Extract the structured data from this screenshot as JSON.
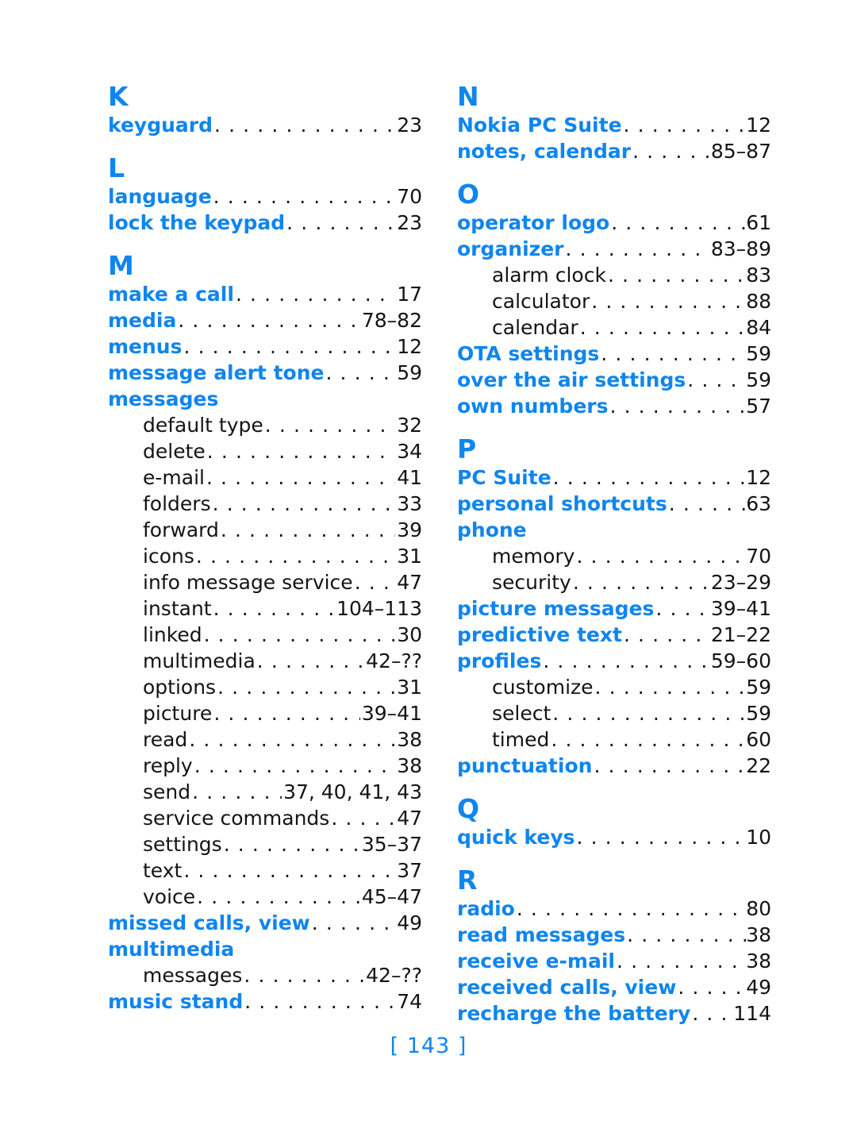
{
  "document": {
    "type": "index",
    "footer_page_label": "[ 143 ]"
  },
  "columns": [
    {
      "id": "left",
      "blocks": [
        {
          "kind": "letter",
          "letter": "K"
        },
        {
          "kind": "entry",
          "level": "main",
          "label": "keyguard",
          "page": "23"
        },
        {
          "kind": "letter",
          "letter": "L"
        },
        {
          "kind": "entry",
          "level": "main",
          "label": "language",
          "page": "70"
        },
        {
          "kind": "entry",
          "level": "main",
          "label": "lock the keypad",
          "page": "23"
        },
        {
          "kind": "letter",
          "letter": "M"
        },
        {
          "kind": "entry",
          "level": "main",
          "label": "make a call",
          "page": "17"
        },
        {
          "kind": "entry",
          "level": "main",
          "label": "media",
          "page": "78–82"
        },
        {
          "kind": "entry",
          "level": "main",
          "label": "menus",
          "page": "12"
        },
        {
          "kind": "entry",
          "level": "main",
          "label": "message alert tone",
          "page": "59"
        },
        {
          "kind": "entry",
          "level": "main",
          "label": "messages",
          "page": ""
        },
        {
          "kind": "entry",
          "level": "sub",
          "label": "default type",
          "page": "32"
        },
        {
          "kind": "entry",
          "level": "sub",
          "label": "delete",
          "page": "34"
        },
        {
          "kind": "entry",
          "level": "sub",
          "label": "e-mail",
          "page": "41"
        },
        {
          "kind": "entry",
          "level": "sub",
          "label": "folders",
          "page": "33"
        },
        {
          "kind": "entry",
          "level": "sub",
          "label": "forward",
          "page": "39"
        },
        {
          "kind": "entry",
          "level": "sub",
          "label": "icons",
          "page": "31"
        },
        {
          "kind": "entry",
          "level": "sub",
          "label": "info message service",
          "page": "47"
        },
        {
          "kind": "entry",
          "level": "sub",
          "label": "instant",
          "page": "104–113"
        },
        {
          "kind": "entry",
          "level": "sub",
          "label": "linked",
          "page": "30"
        },
        {
          "kind": "entry",
          "level": "sub",
          "label": "multimedia",
          "page": "42–??"
        },
        {
          "kind": "entry",
          "level": "sub",
          "label": "options",
          "page": "31"
        },
        {
          "kind": "entry",
          "level": "sub",
          "label": "picture",
          "page": "39–41"
        },
        {
          "kind": "entry",
          "level": "sub",
          "label": "read",
          "page": "38"
        },
        {
          "kind": "entry",
          "level": "sub",
          "label": "reply",
          "page": "38"
        },
        {
          "kind": "entry",
          "level": "sub",
          "label": "send",
          "page": "37, 40, 41, 43"
        },
        {
          "kind": "entry",
          "level": "sub",
          "label": "service commands",
          "page": "47"
        },
        {
          "kind": "entry",
          "level": "sub",
          "label": "settings",
          "page": "35–37"
        },
        {
          "kind": "entry",
          "level": "sub",
          "label": "text",
          "page": "37"
        },
        {
          "kind": "entry",
          "level": "sub",
          "label": "voice",
          "page": "45–47"
        },
        {
          "kind": "entry",
          "level": "main",
          "label": "missed calls, view",
          "page": "49"
        },
        {
          "kind": "entry",
          "level": "main",
          "label": "multimedia",
          "page": ""
        },
        {
          "kind": "entry",
          "level": "sub",
          "label": "messages",
          "page": "42–??"
        },
        {
          "kind": "entry",
          "level": "main",
          "label": "music stand",
          "page": "74"
        }
      ]
    },
    {
      "id": "right",
      "blocks": [
        {
          "kind": "letter",
          "letter": "N"
        },
        {
          "kind": "entry",
          "level": "main",
          "label": "Nokia PC Suite",
          "page": "12"
        },
        {
          "kind": "entry",
          "level": "main",
          "label": "notes, calendar",
          "page": "85–87"
        },
        {
          "kind": "letter",
          "letter": "O"
        },
        {
          "kind": "entry",
          "level": "main",
          "label": "operator logo",
          "page": "61"
        },
        {
          "kind": "entry",
          "level": "main",
          "label": "organizer",
          "page": "83–89"
        },
        {
          "kind": "entry",
          "level": "sub",
          "label": "alarm clock",
          "page": "83"
        },
        {
          "kind": "entry",
          "level": "sub",
          "label": "calculator",
          "page": "88"
        },
        {
          "kind": "entry",
          "level": "sub",
          "label": "calendar",
          "page": "84"
        },
        {
          "kind": "entry",
          "level": "main",
          "label": "OTA settings",
          "page": "59"
        },
        {
          "kind": "entry",
          "level": "main",
          "label": "over the air settings",
          "page": "59"
        },
        {
          "kind": "entry",
          "level": "main",
          "label": "own numbers",
          "page": "57"
        },
        {
          "kind": "letter",
          "letter": "P"
        },
        {
          "kind": "entry",
          "level": "main",
          "label": "PC Suite",
          "page": "12"
        },
        {
          "kind": "entry",
          "level": "main",
          "label": "personal shortcuts",
          "page": "63"
        },
        {
          "kind": "entry",
          "level": "main",
          "label": "phone",
          "page": ""
        },
        {
          "kind": "entry",
          "level": "sub",
          "label": "memory",
          "page": "70"
        },
        {
          "kind": "entry",
          "level": "sub",
          "label": "security",
          "page": "23–29"
        },
        {
          "kind": "entry",
          "level": "main",
          "label": "picture messages",
          "page": "39–41"
        },
        {
          "kind": "entry",
          "level": "main",
          "label": "predictive text",
          "page": "21–22"
        },
        {
          "kind": "entry",
          "level": "main",
          "label": "profiles",
          "page": "59–60"
        },
        {
          "kind": "entry",
          "level": "sub",
          "label": "customize",
          "page": "59"
        },
        {
          "kind": "entry",
          "level": "sub",
          "label": "select",
          "page": "59"
        },
        {
          "kind": "entry",
          "level": "sub",
          "label": "timed",
          "page": "60"
        },
        {
          "kind": "entry",
          "level": "main",
          "label": "punctuation",
          "page": "22"
        },
        {
          "kind": "letter",
          "letter": "Q"
        },
        {
          "kind": "entry",
          "level": "main",
          "label": "quick keys",
          "page": "10"
        },
        {
          "kind": "letter",
          "letter": "R"
        },
        {
          "kind": "entry",
          "level": "main",
          "label": "radio",
          "page": "80"
        },
        {
          "kind": "entry",
          "level": "main",
          "label": "read messages",
          "page": "38"
        },
        {
          "kind": "entry",
          "level": "main",
          "label": "receive e-mail",
          "page": "38"
        },
        {
          "kind": "entry",
          "level": "main",
          "label": "received calls, view",
          "page": "49"
        },
        {
          "kind": "entry",
          "level": "main",
          "label": "recharge the battery",
          "page": "114"
        }
      ]
    }
  ],
  "colors": {
    "accent_blue": "#0f85ee",
    "body_black": "#141414",
    "page_background": "#ffffff"
  }
}
